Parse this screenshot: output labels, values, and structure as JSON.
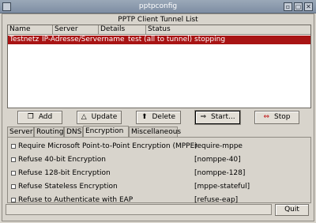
{
  "window": {
    "title": "pptpconfig",
    "controls": {
      "minimize": "▫",
      "maximize": "▢",
      "close": "✕"
    }
  },
  "list": {
    "title": "PPTP Client Tunnel List",
    "columns": [
      "Name",
      "Server",
      "Details",
      "Status"
    ],
    "rows": [
      {
        "name": "Testnetz",
        "server": "IP-Adresse/Servername",
        "details": "test (all to tunnel)",
        "status": "stopping"
      }
    ]
  },
  "toolbar": {
    "add": "Add",
    "update": "Update",
    "delete": "Delete",
    "start": "Start...",
    "stop": "Stop"
  },
  "tabs": [
    "Server",
    "Routing",
    "DNS",
    "Encryption",
    "Miscellaneous"
  ],
  "active_tab": "Encryption",
  "encryption": {
    "options": [
      {
        "label": "Require Microsoft Point-to-Point Encryption (MPPE)",
        "value": "require-mppe",
        "checked": false
      },
      {
        "label": "Refuse 40-bit Encryption",
        "value": "[nomppe-40]",
        "checked": false
      },
      {
        "label": "Refuse 128-bit Encryption",
        "value": "[nomppe-128]",
        "checked": false
      },
      {
        "label": "Refuse Stateless Encryption",
        "value": "[mppe-stateful]",
        "checked": false
      },
      {
        "label": "Refuse to Authenticate with EAP",
        "value": "[refuse-eap]",
        "checked": false
      }
    ]
  },
  "status": {
    "text": ""
  },
  "quit_label": "Quit",
  "colors": {
    "selection": "#a81414",
    "titlebar": "#8c9aae"
  }
}
